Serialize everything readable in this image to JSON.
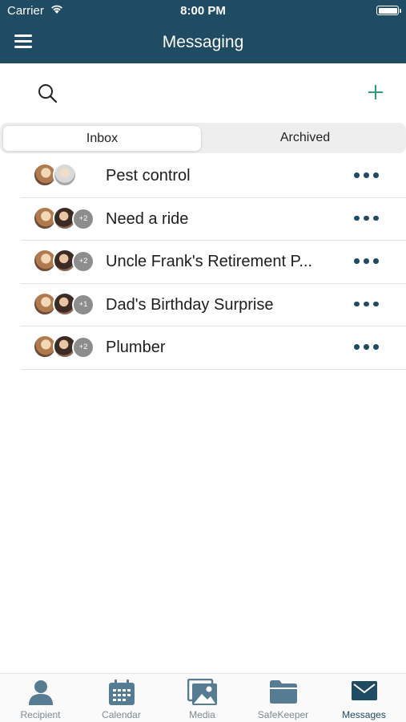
{
  "status_bar": {
    "carrier": "Carrier",
    "time": "8:00 PM"
  },
  "header": {
    "title": "Messaging"
  },
  "segments": {
    "inbox": "Inbox",
    "archived": "Archived",
    "selected": "Inbox"
  },
  "conversations": [
    {
      "title": "Pest control",
      "extra": ""
    },
    {
      "title": "Need a ride",
      "extra": "+2"
    },
    {
      "title": "Uncle Frank's Retirement P...",
      "extra": "+2"
    },
    {
      "title": "Dad's Birthday Surprise",
      "extra": "+1"
    },
    {
      "title": "Plumber",
      "extra": "+2"
    }
  ],
  "tabs": [
    {
      "label": "Recipient",
      "icon": "person-icon"
    },
    {
      "label": "Calendar",
      "icon": "calendar-icon"
    },
    {
      "label": "Media",
      "icon": "photos-icon"
    },
    {
      "label": "SafeKeeper",
      "icon": "folder-icon"
    },
    {
      "label": "Messages",
      "icon": "envelope-icon"
    }
  ],
  "active_tab": "Messages",
  "colors": {
    "header": "#1f4b63",
    "accent": "#2e9a78",
    "tab_inactive": "#7c8a93"
  }
}
